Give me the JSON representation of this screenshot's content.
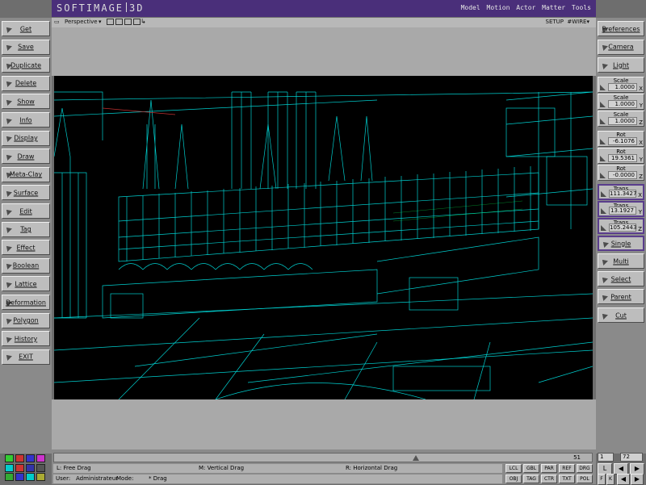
{
  "app": {
    "logo_left": "SOFTIMAGE",
    "logo_right": "3D",
    "modules": [
      "Model",
      "Motion",
      "Actor",
      "Matter",
      "Tools"
    ]
  },
  "left_menu": [
    "Get",
    "Save",
    "Duplicate",
    "Delete",
    "Show",
    "Info",
    "Display",
    "Draw",
    "Meta-Clay",
    "Surface",
    "Edit",
    "Tag",
    "Effect",
    "Boolean",
    "Lattice",
    "Deformation",
    "Polygon",
    "History",
    "EXIT"
  ],
  "viewport": {
    "camera": "Perspective",
    "setup": "SETUP",
    "mode": "WIRE",
    "icons": [
      "arrow-down-icon",
      "view-square-icon",
      "view-square-icon",
      "view-square-icon",
      "view-square-icon",
      "cursor-icon"
    ]
  },
  "right_top": [
    "Preferences",
    "Camera",
    "Light"
  ],
  "transform": {
    "scale": [
      {
        "label": "Scale",
        "value": "1.0000",
        "axis": "X"
      },
      {
        "label": "Scale",
        "value": "1.0000",
        "axis": "Y"
      },
      {
        "label": "Scale",
        "value": "1.0000",
        "axis": "Z"
      }
    ],
    "rot": [
      {
        "label": "Rot",
        "value": "-6.1076",
        "axis": "X"
      },
      {
        "label": "Rot",
        "value": "19.5361",
        "axis": "Y"
      },
      {
        "label": "Rot",
        "value": "-0.0000",
        "axis": "Z"
      }
    ],
    "trans": [
      {
        "label": "Trans",
        "value": "111.3427",
        "axis": "X"
      },
      {
        "label": "Trans",
        "value": "13.1927",
        "axis": "Y"
      },
      {
        "label": "Trans",
        "value": "105.2443",
        "axis": "Z"
      }
    ]
  },
  "right_bottom": [
    "Single",
    "Multi",
    "Select",
    "Parent",
    "Cut"
  ],
  "timeline": {
    "current": "51"
  },
  "mouse": {
    "l": "L:   Free Drag",
    "m": "M:   Vertical Drag",
    "r": "R:   Horizontal Drag"
  },
  "status": {
    "user_label": "User:",
    "user": "Administrateur",
    "mode_label": "Mode:",
    "mode": "*  Drag"
  },
  "mode_buttons_row1": [
    "LCL",
    "GBL",
    "PAR",
    "REF",
    "DRG"
  ],
  "mode_buttons_row2": [
    "OBJ",
    "TAG",
    "CTR",
    "TXT",
    "POL"
  ],
  "frames": {
    "start": "1",
    "end": "72",
    "current": "L",
    "keys": [
      "F",
      "K"
    ]
  },
  "palette": [
    "#33cc33",
    "#cc3333",
    "#3333cc",
    "#cc33cc",
    "#00cccc",
    "#cc3333",
    "#3333aa",
    "#555555",
    "#33aa33",
    "#3333cc",
    "#00cccc",
    "#aaaa33"
  ],
  "colors": {
    "wire": "#00e6e6",
    "title": "#4a2f7a",
    "panel": "#bdbdbd"
  }
}
